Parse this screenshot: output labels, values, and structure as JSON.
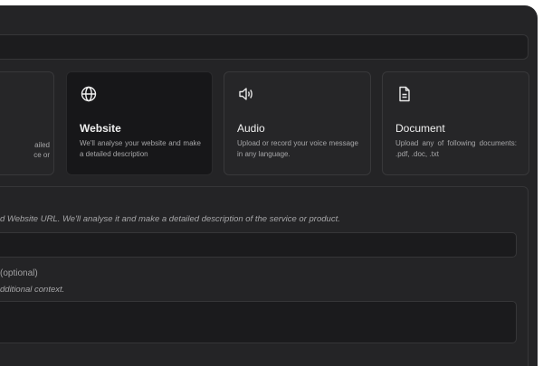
{
  "options": [
    {
      "partial_lines": [
        "ailed",
        "ce or"
      ]
    },
    {
      "title": "Website",
      "description": "We'll analyse your website and make a detailed description",
      "icon": "globe-icon",
      "selected": true
    },
    {
      "title": "Audio",
      "description": "Upload or record your voice message in any language.",
      "icon": "speaker-icon",
      "selected": false
    },
    {
      "title": "Document",
      "description": "Upload any of following documents: .pdf, .doc, .txt",
      "icon": "document-icon",
      "selected": false
    }
  ],
  "form": {
    "url_hint": "d Website URL. We'll analyse it and make a detailed description of the service or product.",
    "url_value": "",
    "context_label": "(optional)",
    "context_hint": "dditional context.",
    "context_value": ""
  },
  "colors": {
    "background": "#242426",
    "card": "#262628",
    "card_selected": "#171719",
    "input": "#1b1b1d",
    "border": "#363638"
  }
}
